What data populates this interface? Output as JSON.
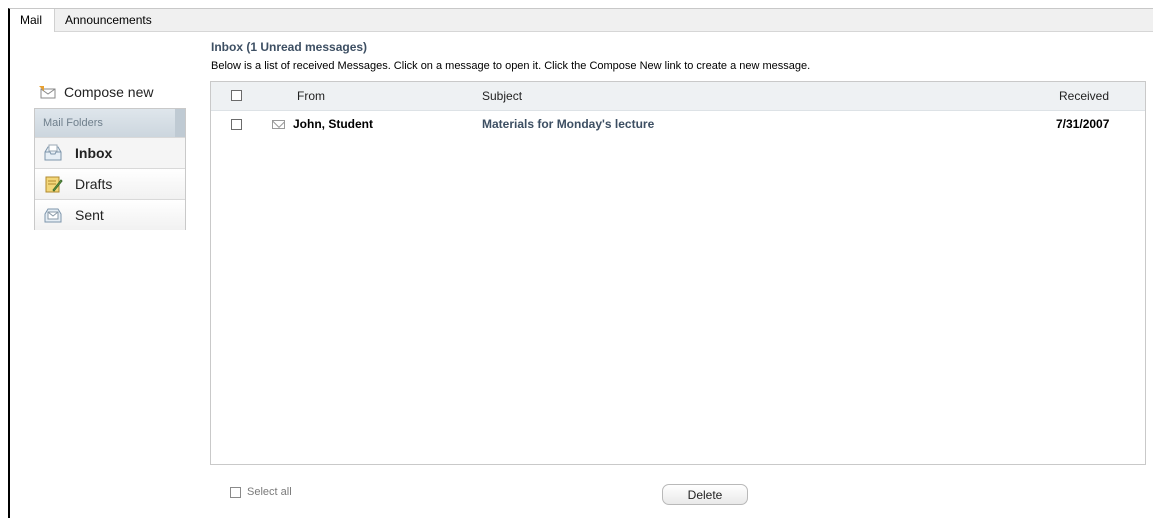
{
  "tabs": [
    {
      "label": "Mail"
    },
    {
      "label": "Announcements"
    }
  ],
  "sidebar": {
    "compose_label": "Compose new",
    "folders_header": "Mail Folders",
    "folders": [
      {
        "label": "Inbox",
        "icon": "inbox-icon",
        "active": true
      },
      {
        "label": "Drafts",
        "icon": "drafts-icon",
        "active": false
      },
      {
        "label": "Sent",
        "icon": "sent-icon",
        "active": false
      }
    ]
  },
  "main": {
    "title": "Inbox (1 Unread messages)",
    "description": "Below is a list of received Messages. Click on a message to open it. Click the Compose New link to create a new message.",
    "columns": {
      "from": "From",
      "subject": "Subject",
      "received": "Received"
    },
    "messages": [
      {
        "from": "John, Student",
        "subject": "Materials for Monday's lecture",
        "received": "7/31/2007",
        "unread": true
      }
    ]
  },
  "footer": {
    "select_all_label": "Select all",
    "delete_label": "Delete"
  },
  "colors": {
    "title": "#3d4f63",
    "folder_header_bg": "#ccd6de",
    "list_header_bg": "#eef1f3"
  }
}
